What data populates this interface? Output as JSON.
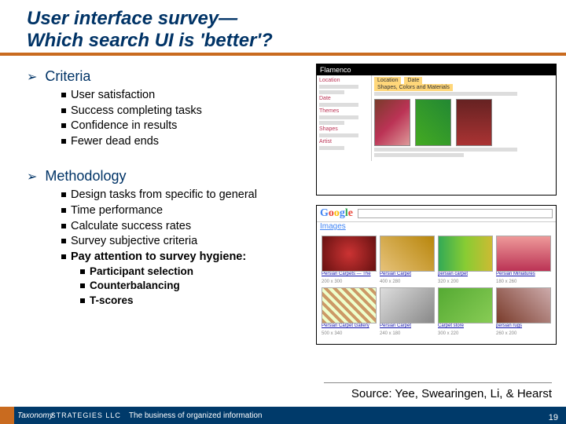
{
  "title_line1": "User interface survey—",
  "title_line2": " Which search UI is 'better'?",
  "sections": {
    "criteria": {
      "heading": "Criteria",
      "items": [
        "User satisfaction",
        "Success completing tasks",
        "Confidence in results",
        "Fewer dead ends"
      ]
    },
    "methodology": {
      "heading": "Methodology",
      "items": [
        "Design tasks from specific to general",
        "Time performance",
        "Calculate success rates",
        "Survey subjective criteria",
        "Pay attention to survey hygiene:"
      ],
      "sub_items": [
        "Participant selection",
        "Counterbalancing",
        "T-scores"
      ]
    }
  },
  "mock": {
    "flamenco_label": "Flamenco",
    "tab1": "Location",
    "tab2": "Date",
    "tab3": "Shapes, Colors and Materials",
    "side_labels": [
      "Location",
      "Date",
      "Themes",
      "Shapes",
      "Artist"
    ],
    "google_logo": [
      "G",
      "o",
      "o",
      "g",
      "l",
      "e"
    ],
    "images_label": "Images",
    "g_caps": [
      "Persian Carpets — The",
      "Persian Carpet",
      "persian carpet",
      "Persian Miniatures",
      "Persian Carpet Gallery",
      "Persian Carpet",
      "Carpet store",
      "persian rugs"
    ]
  },
  "source": "Source: Yee, Swearingen, Li, & Hearst",
  "footer": {
    "brand_italic": "Taxonomy",
    "brand_caps": "STRATEGIES LLC",
    "tagline": "The business of organized information",
    "page": "19"
  }
}
